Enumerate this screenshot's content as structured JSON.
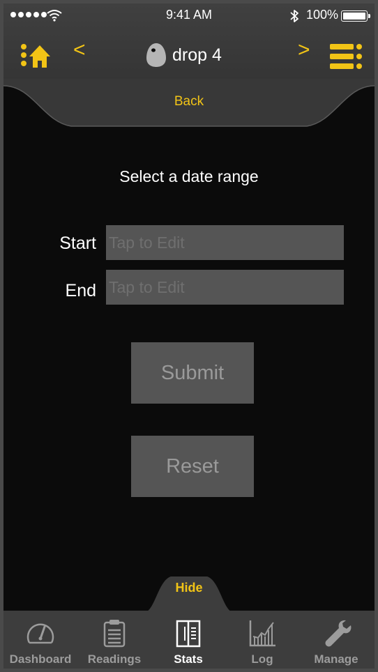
{
  "status_bar": {
    "time": "9:41 AM",
    "battery": "100%",
    "icons": [
      "signal-dots-icon",
      "wifi-icon",
      "bluetooth-icon",
      "battery-icon"
    ]
  },
  "nav": {
    "device_name": "drop 4",
    "prev_icon": "chevron-left-icon",
    "next_icon": "chevron-right-icon",
    "home_icon": "home-icon",
    "menu_icon": "menu-icon",
    "chevron_left": "<",
    "chevron_right": ">"
  },
  "back_label": "Back",
  "prompt": "Select a date range",
  "form": {
    "start_label": "Start",
    "end_label": "End",
    "start_placeholder": "Tap to Edit",
    "end_placeholder": "Tap to Edit",
    "start_value": "",
    "end_value": ""
  },
  "buttons": {
    "submit": "Submit",
    "reset": "Reset"
  },
  "hide_label": "Hide",
  "tabs": [
    {
      "label": "Dashboard",
      "icon": "gauge-icon",
      "active": false
    },
    {
      "label": "Readings",
      "icon": "clipboard-icon",
      "active": false
    },
    {
      "label": "Stats",
      "icon": "stats-book-icon",
      "active": true
    },
    {
      "label": "Log",
      "icon": "bar-chart-icon",
      "active": false
    },
    {
      "label": "Manage",
      "icon": "wrench-icon",
      "active": false
    }
  ],
  "colors": {
    "accent": "#f2c416",
    "background": "#0b0b0b",
    "header": "#3d3d3d",
    "field": "#555555"
  }
}
